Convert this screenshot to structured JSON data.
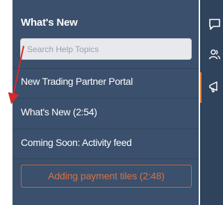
{
  "help_panel": {
    "title": "What's New",
    "search": {
      "placeholder": "Search Help Topics",
      "value": ""
    },
    "items": [
      {
        "label": "New Trading Partner Portal"
      },
      {
        "label": "What's New (2:54)"
      },
      {
        "label": "Coming Soon: Activity feed"
      }
    ],
    "cta_button": {
      "label": "Adding payment tiles (2:48)"
    }
  },
  "side_rail": {
    "icons": [
      "chat-bubble-icon",
      "people-icon",
      "megaphone-icon"
    ],
    "active_icon": "megaphone-icon"
  },
  "annotation": {
    "arrow_color": "#d62a2a",
    "target": "What's New (2:54)"
  },
  "colors": {
    "panel_background": "#3a506c",
    "rail_background": "#2f435c",
    "accent_orange": "#d6734a",
    "active_indicator": "#e0823a"
  }
}
